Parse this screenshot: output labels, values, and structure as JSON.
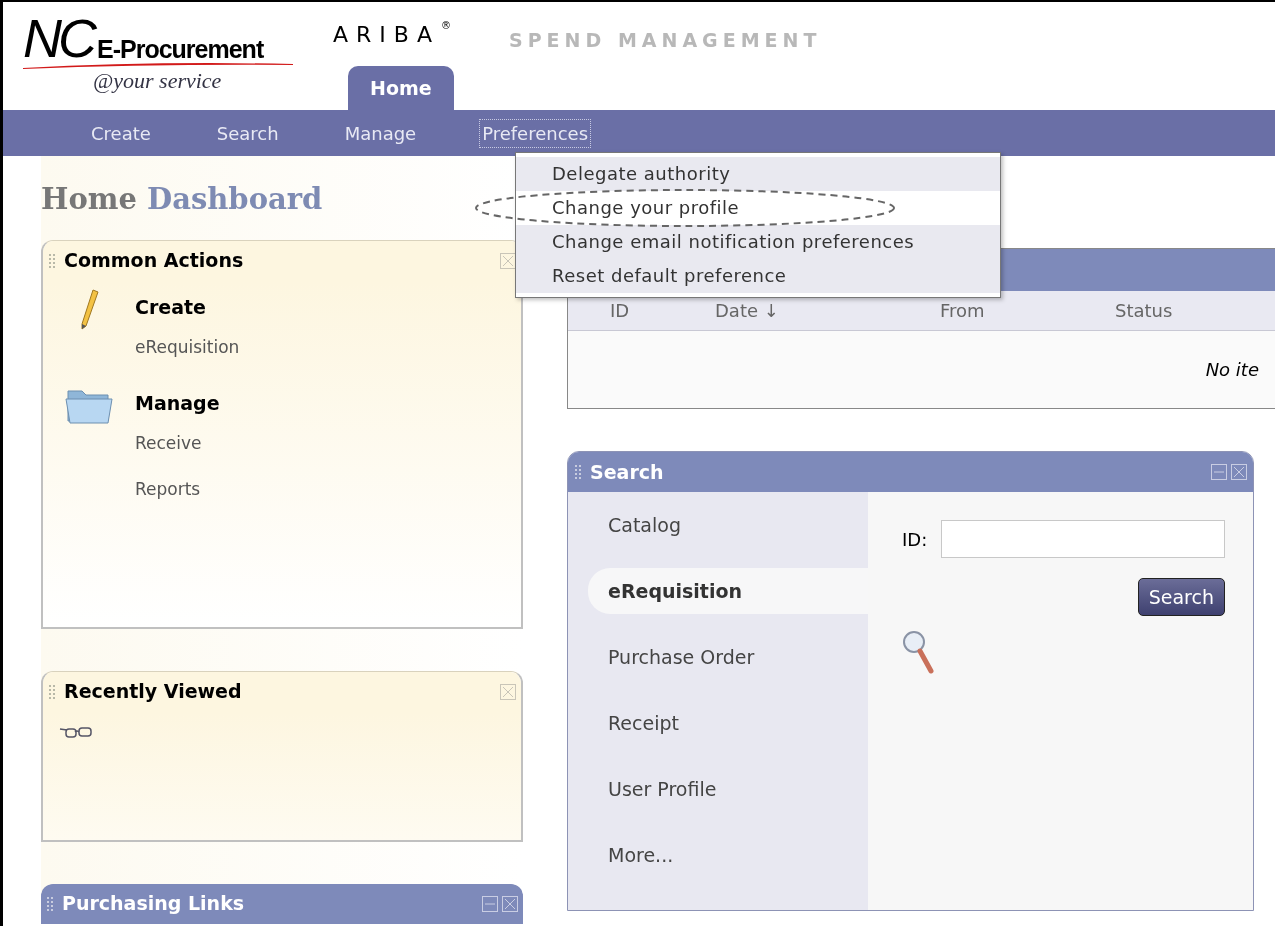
{
  "header": {
    "logo_initials": "NC",
    "logo_name": "E-Procurement",
    "logo_tagline": "@your service",
    "brand": "ARIBA",
    "brand_mark": "®",
    "tagline": "SPEND MANAGEMENT"
  },
  "tabs": [
    {
      "label": "Home",
      "selected": true
    }
  ],
  "nav": [
    {
      "label": "Create",
      "expanded": false
    },
    {
      "label": "Search",
      "expanded": false
    },
    {
      "label": "Manage",
      "expanded": false
    },
    {
      "label": "Preferences",
      "expanded": true
    }
  ],
  "dropdown": [
    {
      "label": "Delegate authority",
      "selected": false
    },
    {
      "label": "Change your profile",
      "selected": true
    },
    {
      "label": "Change email notification preferences",
      "selected": false
    },
    {
      "label": "Reset default preference",
      "selected": false
    }
  ],
  "page_title": {
    "first": "Home",
    "second": "Dashboard"
  },
  "left_panels": [
    {
      "kind": "actions",
      "title": "Common Actions",
      "minimizable": false,
      "groups": [
        {
          "kind": "create",
          "heading": "Create",
          "links": [
            "eRequisition"
          ]
        },
        {
          "kind": "manage",
          "heading": "Manage",
          "links": [
            "Receive",
            "Reports"
          ]
        }
      ]
    },
    {
      "kind": "recent",
      "title": "Recently Viewed",
      "minimizable": false
    },
    {
      "kind": "links",
      "title": "Purchasing Links",
      "minimizable": true
    }
  ],
  "todo": {
    "columns": [
      "ID",
      "Date ↓",
      "From",
      "Status"
    ],
    "empty_message": "No ite"
  },
  "search": {
    "title": "Search",
    "minimizable": true,
    "categories": [
      {
        "label": "Catalog",
        "selected": false
      },
      {
        "label": "eRequisition",
        "selected": true
      },
      {
        "label": "Purchase Order",
        "selected": false
      },
      {
        "label": "Receipt",
        "selected": false
      },
      {
        "label": "User Profile",
        "selected": false
      },
      {
        "label": "More...",
        "selected": false
      }
    ],
    "field_label": "ID:",
    "button": "Search"
  }
}
